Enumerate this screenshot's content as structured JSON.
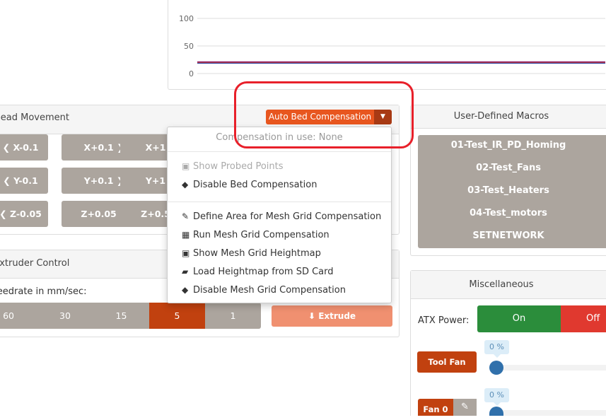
{
  "chart": {
    "y_ticks": [
      "100",
      "50",
      "0"
    ],
    "ylim": [
      0,
      100
    ],
    "series_colors": [
      "#8a1f7a",
      "#d43a2a",
      "#2a3fa0"
    ],
    "value": 20
  },
  "head_movement": {
    "title": "Head Movement",
    "rows": [
      [
        "X-0.1",
        "X+0.1",
        "X+1"
      ],
      [
        "Y-0.1",
        "Y+0.1",
        "Y+1"
      ],
      [
        "Z-0.05",
        "Z+0.05",
        "Z+0.5"
      ]
    ],
    "auto_bed_label": "Auto Bed Compensation",
    "accent": "#e8561f"
  },
  "bed_menu": {
    "header": "Compensation in use: None",
    "items": [
      {
        "label": "Show Probed Points",
        "icon": "square-icon",
        "disabled": true
      },
      {
        "label": "Disable Bed Compensation",
        "icon": "eraser-icon"
      }
    ],
    "items2": [
      {
        "label": "Define Area for Mesh Grid Compensation",
        "icon": "edit-icon"
      },
      {
        "label": "Run Mesh Grid Compensation",
        "icon": "grid-icon"
      },
      {
        "label": "Show Mesh Grid Heightmap",
        "icon": "square-icon"
      },
      {
        "label": "Load Heightmap from SD Card",
        "icon": "folder-open-icon"
      },
      {
        "label": "Disable Mesh Grid Compensation",
        "icon": "eraser-icon"
      }
    ]
  },
  "extruder": {
    "title": "Extruder Control",
    "feedrate_label": "Feedrate in mm/sec:",
    "feedrates": [
      "60",
      "30",
      "15",
      "5",
      "1"
    ],
    "selected": "5",
    "extrude_label": "Extrude"
  },
  "macros": {
    "title": "User-Defined Macros",
    "items": [
      "01-Test_IR_PD_Homing",
      "02-Test_Fans",
      "03-Test_Heaters",
      "04-Test_motors",
      "SETNETWORK"
    ]
  },
  "misc": {
    "title": "Miscellaneous",
    "atx_label": "ATX Power:",
    "on_label": "On",
    "off_label": "Off",
    "fans": [
      {
        "label": "Tool Fan",
        "value": "0 %"
      },
      {
        "label": "Fan 0",
        "value": "0 %"
      }
    ]
  }
}
